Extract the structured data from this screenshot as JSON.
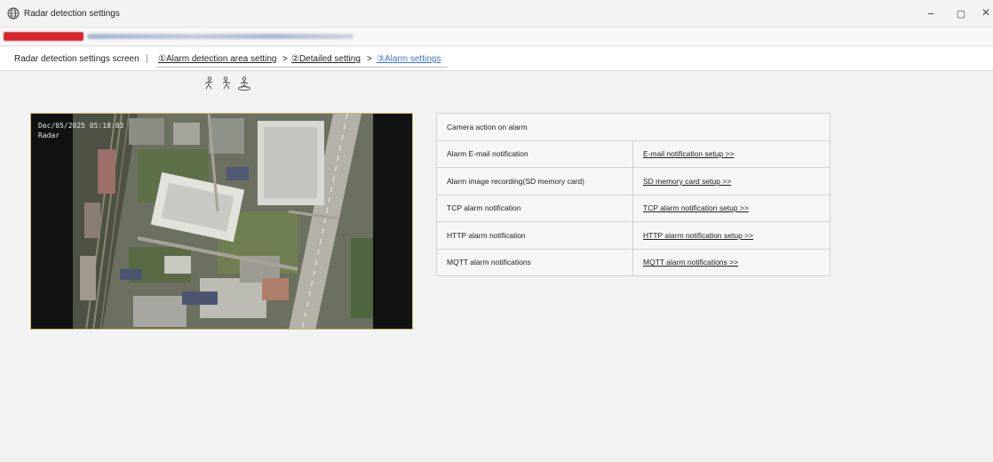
{
  "window": {
    "title": "Radar detection settings",
    "controls": {
      "minimize": "−",
      "maximize": "▢",
      "close": "×"
    }
  },
  "breadcrumb": {
    "screen": "Radar detection settings screen",
    "separator": "|",
    "step1": "①Alarm detection area setting",
    "step2": "②Detailed setting",
    "step3": "③Alarm settings",
    "arrow": ">"
  },
  "ptz_icons": [
    "walker-left-icon",
    "walker-right-icon",
    "walker-target-icon"
  ],
  "camera": {
    "timestamp": "Dec/05/2025 05:18:03",
    "label": "Radar"
  },
  "alarm_table": {
    "header": "Camera action on alarm",
    "rows": [
      {
        "label": "Alarm E-mail notification",
        "link": "E-mail notification setup >>"
      },
      {
        "label": "Alarm image recording(SD memory card)",
        "link": "SD memory card setup >>"
      },
      {
        "label": "TCP alarm notification",
        "link": "TCP alarm notification setup >>"
      },
      {
        "label": "HTTP alarm notification",
        "link": "HTTP alarm notification setup >>"
      },
      {
        "label": "MQTT alarm notifications",
        "link": "MQTT alarm notifications >>"
      }
    ]
  },
  "colors": {
    "accent_link": "#3a74c4",
    "address_redaction": "#d9242c",
    "camera_border": "#c8b96a"
  }
}
